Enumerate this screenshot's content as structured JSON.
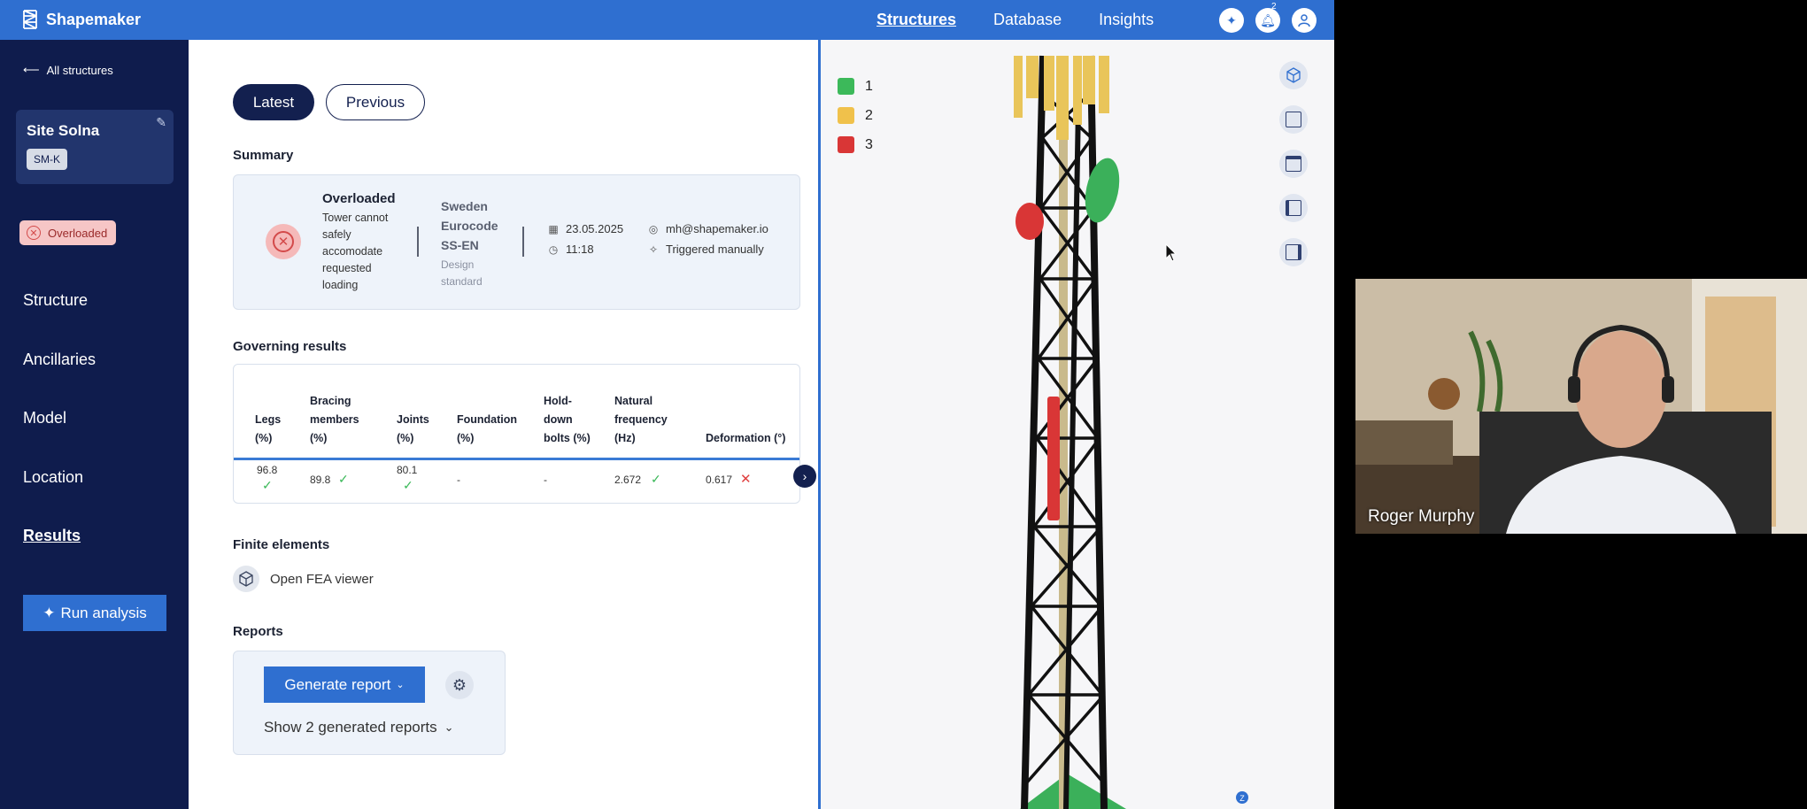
{
  "header": {
    "brand": "Shapemaker",
    "nav": [
      "Structures",
      "Database",
      "Insights"
    ],
    "notification_count": "2"
  },
  "sidebar": {
    "back_link": "All structures",
    "site_name": "Site Solna",
    "site_tag": "SM-K",
    "status": "Overloaded",
    "items": [
      {
        "label": "Structure"
      },
      {
        "label": "Ancillaries"
      },
      {
        "label": "Model"
      },
      {
        "label": "Location"
      },
      {
        "label": "Results"
      }
    ],
    "run_button": "Run analysis"
  },
  "main": {
    "tabs": [
      "Latest",
      "Previous"
    ],
    "summary": {
      "title": "Summary",
      "status_title": "Overloaded",
      "status_desc": "Tower cannot safely accomodate requested loading",
      "standard_name": "Sweden Eurocode SS-EN",
      "standard_label": "Design standard",
      "date": "23.05.2025",
      "time": "11:18",
      "email": "mh@shapemaker.io",
      "trigger": "Triggered manually"
    },
    "governing": {
      "title": "Governing results",
      "columns": [
        "Legs (%)",
        "Bracing members (%)",
        "Joints (%)",
        "Foundation (%)",
        "Hold-down bolts (%)",
        "Natural frequency (Hz)",
        "Deformation (°)"
      ],
      "values": [
        "96.8",
        "89.8",
        "80.1",
        "-",
        "-",
        "2.672",
        "0.617"
      ]
    },
    "finite_elements": {
      "title": "Finite elements",
      "link": "Open FEA viewer"
    },
    "reports": {
      "title": "Reports",
      "generate_button": "Generate report",
      "show_link": "Show 2 generated reports"
    }
  },
  "viewer": {
    "legend": [
      {
        "label": "1",
        "color": "#3cb95a"
      },
      {
        "label": "2",
        "color": "#f0c14b"
      },
      {
        "label": "3",
        "color": "#d93636"
      }
    ],
    "axis_badge": "Z"
  },
  "webcam": {
    "name": "Roger Murphy"
  },
  "colors": {
    "brand_blue": "#2f6fd0",
    "sidebar_navy": "#0f1c4d",
    "ok_green": "#3cb95a",
    "error_red": "#e04040"
  }
}
